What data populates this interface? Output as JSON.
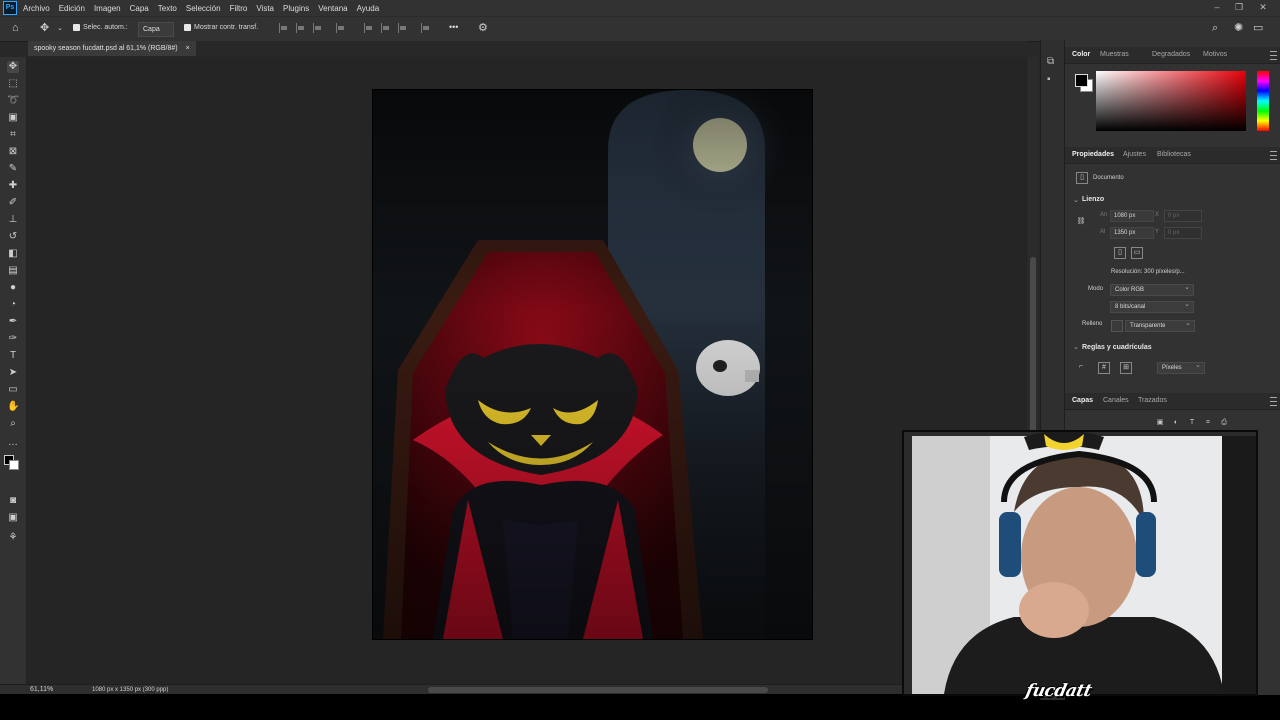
{
  "app": {
    "logo_text": "Ps",
    "menu": [
      "Archivo",
      "Edición",
      "Imagen",
      "Capa",
      "Texto",
      "Selección",
      "Filtro",
      "Vista",
      "Plugins",
      "Ventana",
      "Ayuda"
    ]
  },
  "options_bar": {
    "auto_select_label": "Selec. autom.:",
    "auto_select_value": "Capa",
    "show_transform_label": "Mostrar contr. transf.",
    "more_icon": "•••"
  },
  "document": {
    "tab_title": "spooky season fucdatt.psd al 61,1% (RGB/8#)",
    "close_icon": "×"
  },
  "status": {
    "zoom": "61,11%",
    "dimensions": "1080 px x 1350 px (300 ppp)"
  },
  "color_panel": {
    "tabs": [
      "Color",
      "Muestras",
      "Degradados",
      "Motivos"
    ],
    "active_tab": "Color",
    "foreground": "#000000",
    "background": "#ffffff",
    "hue": "#e8000a"
  },
  "properties_panel": {
    "tabs": [
      "Propiedades",
      "Ajustes",
      "Bibliotecas"
    ],
    "doc_label": "Documento",
    "canvas_section": "Lienzo",
    "width_label": "An",
    "width_value": "1080 px",
    "height_label": "Al",
    "height_value": "1350 px",
    "x_label": "X",
    "x_value": "0 px",
    "y_label": "Y",
    "y_value": "0 px",
    "resolution": "Resolución: 300 píxeles/p...",
    "mode_label": "Modo",
    "mode_value": "Color RGB",
    "bits_value": "8 bits/canal",
    "fill_label": "Relleno",
    "fill_value": "Transparente",
    "rulers_section": "Reglas y cuadrículas",
    "units_value": "Píxeles"
  },
  "layers_panel": {
    "tabs": [
      "Capas",
      "Canales",
      "Trazados"
    ]
  },
  "watermark": "fucdatt",
  "colors": {
    "canvas_bg": "#101214",
    "moon": "#f4f6c8",
    "cape_red": "#e0142e",
    "eyes": "#f2d22e",
    "coffin_inner": "#7a0814"
  }
}
